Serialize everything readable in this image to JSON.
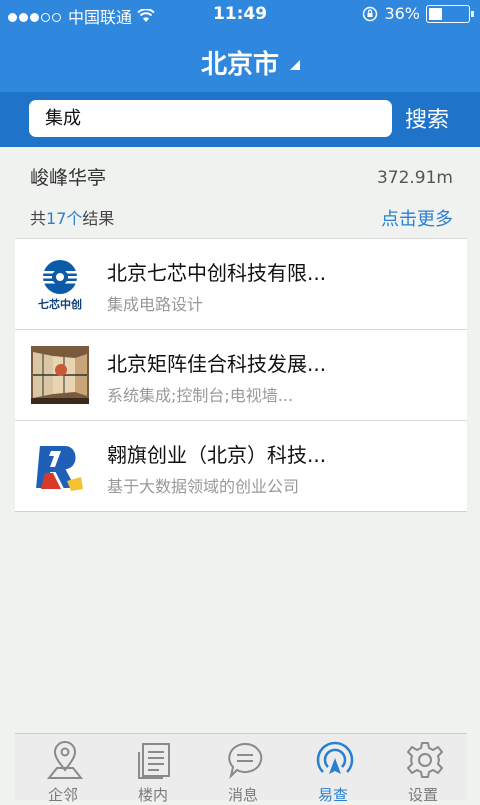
{
  "status": {
    "carrier": "中国联通",
    "time": "11:49",
    "battery": "36%"
  },
  "nav": {
    "title": "北京市"
  },
  "search": {
    "value": "集成",
    "button": "搜索"
  },
  "location": {
    "name": "峻峰华亭",
    "distance": "372.91m",
    "count_prefix": "共",
    "count_value": "17个",
    "count_suffix": "结果",
    "more": "点击更多"
  },
  "results": [
    {
      "title": "北京七芯中创科技有限...",
      "desc": "集成电路设计",
      "logo_text": "七芯中创",
      "icon": "qixin-logo-icon"
    },
    {
      "title": "北京矩阵佳合科技发展...",
      "desc": "系统集成;控制台;电视墙...",
      "icon": "video-wall-photo-icon"
    },
    {
      "title": "翱旗创业（北京）科技...",
      "desc": "基于大数据领域的创业公司",
      "icon": "r-logo-icon"
    }
  ],
  "tabs": [
    {
      "label": "企邻",
      "icon": "map-pin-icon",
      "active": false
    },
    {
      "label": "楼内",
      "icon": "document-icon",
      "active": false
    },
    {
      "label": "消息",
      "icon": "chat-icon",
      "active": false
    },
    {
      "label": "易查",
      "icon": "radar-icon",
      "active": true
    },
    {
      "label": "设置",
      "icon": "gear-icon",
      "active": false
    }
  ],
  "colors": {
    "primary": "#2f88dd",
    "search_bar": "#1f73c8",
    "accent": "#2a7fd2"
  }
}
